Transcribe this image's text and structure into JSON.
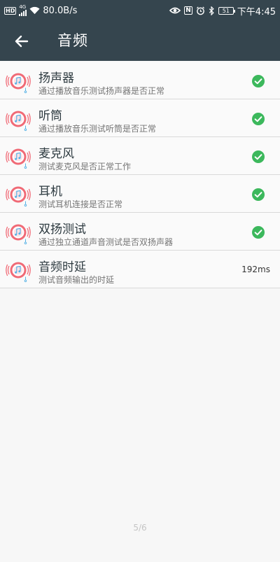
{
  "status_bar": {
    "hd_label": "HD",
    "network_label": "4G",
    "speed": "80.0B/s",
    "nfc_label": "N",
    "battery_level": "51",
    "time": "下午4:45"
  },
  "toolbar": {
    "title": "音频"
  },
  "items": [
    {
      "title": "扬声器",
      "subtitle": "通过播放音乐测试扬声器是否正常",
      "status": "pass"
    },
    {
      "title": "听筒",
      "subtitle": "通过播放音乐测试听筒是否正常",
      "status": "pass"
    },
    {
      "title": "麦克风",
      "subtitle": "测试麦克风是否正常工作",
      "status": "pass"
    },
    {
      "title": "耳机",
      "subtitle": "测试耳机连接是否正常",
      "status": "pass"
    },
    {
      "title": "双扬测试",
      "subtitle": "通过独立通道声音测试是否双扬声器",
      "status": "pass"
    },
    {
      "title": "音频时延",
      "subtitle": "测试音频输出的时延",
      "value": "192ms"
    }
  ],
  "pager": "5/6",
  "colors": {
    "header_bg": "#35454e",
    "check_green": "#3cb85c",
    "icon_red": "#f06a76",
    "icon_blue": "#58b3e6"
  },
  "icons": {
    "back": "arrow-left-icon",
    "item": "speaker-music-icon",
    "status": "check-circle-icon"
  }
}
